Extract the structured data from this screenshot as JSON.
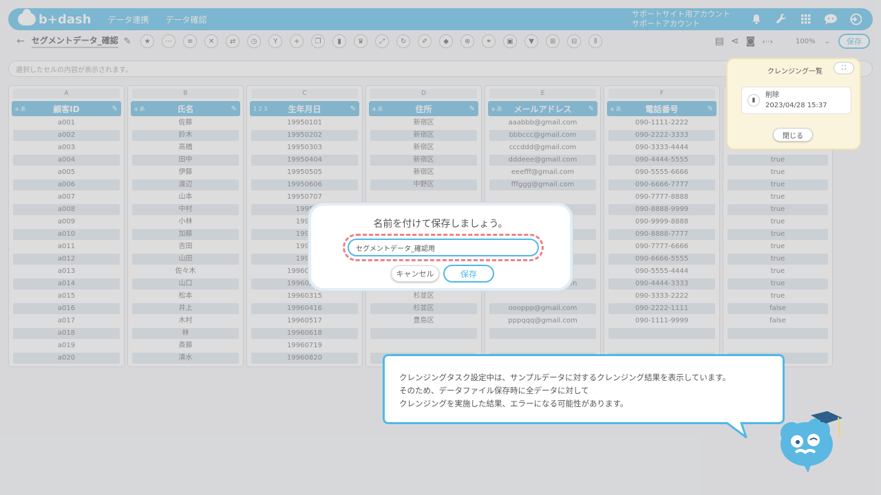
{
  "header": {
    "logo": "b+dash",
    "nav": [
      "データ連携",
      "データ確認"
    ],
    "account_line1": "サポートサイト用アカウント",
    "account_line2": "サポートアカウント",
    "icons": [
      "bell-icon",
      "wrench-icon",
      "grid-icon",
      "chat-icon",
      "logout-icon"
    ]
  },
  "toolbar": {
    "back": "←",
    "title": "セグメントデータ_確認",
    "zoom": "100%",
    "save_label": "保存"
  },
  "cellbar": {
    "placeholder": "選択したセルの内容が表示されます。"
  },
  "table": {
    "columns": [
      {
        "letter": "A",
        "name": "顧客ID",
        "type": "a あ"
      },
      {
        "letter": "B",
        "name": "氏名",
        "type": "a あ"
      },
      {
        "letter": "C",
        "name": "生年月日",
        "type": "1 2 3"
      },
      {
        "letter": "D",
        "name": "住所",
        "type": "a あ"
      },
      {
        "letter": "E",
        "name": "メールアドレス",
        "type": "a あ"
      },
      {
        "letter": "F",
        "name": "電話番号",
        "type": "a あ"
      },
      {
        "letter": "",
        "name": "",
        "type": ""
      }
    ],
    "rows": [
      [
        "a001",
        "佐藤",
        "19950101",
        "新宿区",
        "aaabbb@gmail.com",
        "090-1111-2222",
        ""
      ],
      [
        "a002",
        "鈴木",
        "19950202",
        "新宿区",
        "bbbccc@gmail.com",
        "090-2222-3333",
        ""
      ],
      [
        "a003",
        "高橋",
        "19950303",
        "新宿区",
        "cccddd@gmail.com",
        "090-3333-4444",
        "true"
      ],
      [
        "a004",
        "田中",
        "19950404",
        "新宿区",
        "dddeee@gmail.com",
        "090-4444-5555",
        "true"
      ],
      [
        "a005",
        "伊藤",
        "19950505",
        "新宿区",
        "eeefff@gmail.com",
        "090-5555-6666",
        "true"
      ],
      [
        "a006",
        "渡辺",
        "19950606",
        "中野区",
        "fffggg@gmail.com",
        "090-6666-7777",
        "true"
      ],
      [
        "a007",
        "山本",
        "19950707",
        "",
        "",
        "090-7777-8888",
        "true"
      ],
      [
        "a008",
        "中村",
        "1995",
        "",
        "",
        "090-8888-9999",
        "true"
      ],
      [
        "a009",
        "小林",
        "1995",
        "",
        "",
        "090-9999-8888",
        "true"
      ],
      [
        "a010",
        "加藤",
        "1995",
        "",
        "",
        "090-8888-7777",
        "true"
      ],
      [
        "a011",
        "吉田",
        "1995",
        "",
        "",
        "090-7777-6666",
        "true"
      ],
      [
        "a012",
        "山田",
        "1995",
        "",
        "",
        "090-6666-5555",
        "true"
      ],
      [
        "a013",
        "佐々木",
        "19960113",
        "",
        "",
        "090-5555-4444",
        "true"
      ],
      [
        "a014",
        "山口",
        "19960214",
        "杉並区",
        "nnnooo@gmail.com",
        "090-4444-3333",
        "true"
      ],
      [
        "a015",
        "松本",
        "19960315",
        "杉並区",
        "",
        "090-3333-2222",
        "true"
      ],
      [
        "a016",
        "井上",
        "19960416",
        "杉並区",
        "oooppp@gmail.com",
        "090-2222-1111",
        "false"
      ],
      [
        "a017",
        "木村",
        "19960517",
        "豊島区",
        "pppqqq@gmail.com",
        "090-1111-9999",
        "false"
      ],
      [
        "a018",
        "林",
        "19960618",
        "",
        "",
        "",
        ""
      ],
      [
        "a019",
        "斎藤",
        "19960719",
        "",
        "",
        "",
        ""
      ],
      [
        "a020",
        "清水",
        "19960820",
        "",
        "",
        "",
        ""
      ]
    ]
  },
  "cleansing_panel": {
    "title": "クレンジング一覧",
    "item_label": "削除",
    "item_date": "2023/04/28 15:37",
    "close_label": "閉じる"
  },
  "dialog": {
    "title": "名前を付けて保存しましょう。",
    "input_value": "セグメントデータ_確認用",
    "cancel_label": "キャンセル",
    "save_label": "保存"
  },
  "bubble": {
    "line1": "クレンジングタスク設定中は、サンプルデータに対するクレンジング結果を表示しています。",
    "line2": "そのため、データファイル保存時に全データに対して",
    "line3": "クレンジングを実施した結果、エラーになる可能性があります。"
  },
  "colors": {
    "accent": "#4fb8e8",
    "header_col": "#5bb4e0",
    "highlight_dash": "#f07f86"
  }
}
